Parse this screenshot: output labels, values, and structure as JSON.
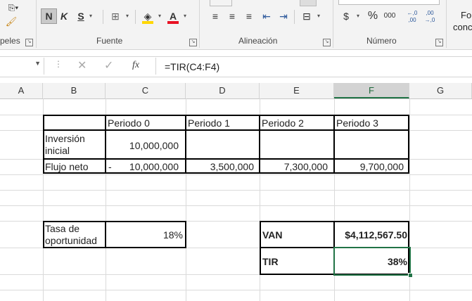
{
  "ribbon": {
    "groups": {
      "font": "Fuente",
      "alignment": "Alineación",
      "number": "Número",
      "clipboard_partial": "peles",
      "styles_partial_1": "Fo",
      "styles_partial_2": "conc"
    },
    "font_buttons": {
      "bold": "N",
      "italic": "K",
      "underline": "S"
    },
    "number_buttons": {
      "currency": "$",
      "percent": "%",
      "thousands": "000",
      "inc_decimal": "←,0 ,00",
      "dec_decimal": ",00 →,0"
    },
    "icons": [
      "paste-icon",
      "format-painter-icon",
      "borders-icon",
      "fill-color-icon",
      "font-color-icon",
      "align-left-icon",
      "align-center-icon",
      "align-right-icon",
      "indent-decrease-icon",
      "indent-increase-icon",
      "merge-center-icon"
    ]
  },
  "formula_bar": {
    "name_box": "",
    "cancel_icon": "✕",
    "enter_icon": "✓",
    "fx_label": "fx",
    "formula": "=TIR(C4:F4)"
  },
  "columns": [
    "A",
    "B",
    "C",
    "D",
    "E",
    "F",
    "G"
  ],
  "selected_column": "F",
  "table": {
    "header": [
      "",
      "Periodo 0",
      "Periodo 1",
      "Periodo 2",
      "Periodo 3"
    ],
    "row_investment": {
      "label_line1": "Inversión",
      "label_line2": "inicial",
      "p0": "10,000,000",
      "p1": "",
      "p2": "",
      "p3": ""
    },
    "row_flow": {
      "label": "Flujo neto",
      "p0_sign": "-",
      "p0": "10,000,000",
      "p1": "3,500,000",
      "p2": "7,300,000",
      "p3": "9,700,000"
    }
  },
  "rate": {
    "label_line1": "Tasa de",
    "label_line2": "oportunidad",
    "value": "18%"
  },
  "results": {
    "van_label": "VAN",
    "van_value": "$4,112,567.50",
    "tir_label": "TIR",
    "tir_value": "38%"
  },
  "colors": {
    "excel_green": "#217346",
    "font_color": "#e81123",
    "fill_color": "#ffd700"
  }
}
